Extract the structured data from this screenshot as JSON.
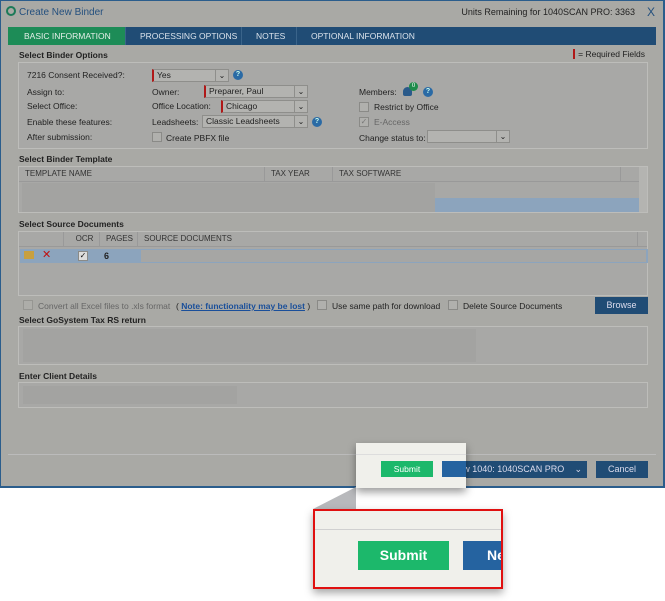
{
  "header": {
    "title": "Create New Binder",
    "units": "Units Remaining for 1040SCAN PRO: 3363",
    "close": "X"
  },
  "tabs": [
    "BASIC INFORMATION",
    "PROCESSING OPTIONS",
    "NOTES",
    "OPTIONAL INFORMATION"
  ],
  "required_legend": "= Required Fields",
  "binder_options": {
    "section": "Select Binder Options",
    "consent_label": "7216 Consent Received?:",
    "consent_value": "Yes",
    "assign_label": "Assign to:",
    "owner_label": "Owner:",
    "owner_value": "Preparer, Paul",
    "members_label": "Members:",
    "members_count": "0",
    "office_label": "Select Office:",
    "location_label": "Office Location:",
    "location_value": "Chicago",
    "restrict_label": "Restrict by Office",
    "features_label": "Enable these features:",
    "leadsheets_label": "Leadsheets:",
    "leadsheets_value": "Classic Leadsheets",
    "eaccess_label": "E-Access",
    "after_label": "After submission:",
    "pbfx_label": "Create PBFX file",
    "status_label": "Change status to:",
    "status_value": ""
  },
  "template": {
    "section": "Select Binder Template",
    "columns": [
      "TEMPLATE NAME",
      "TAX YEAR",
      "TAX SOFTWARE"
    ]
  },
  "source": {
    "section": "Select Source Documents",
    "columns": [
      "OCR",
      "PAGES",
      "SOURCE DOCUMENTS"
    ],
    "row": {
      "pages": "6"
    },
    "convert_label": "Convert all Excel files to .xls format",
    "note_open": "(",
    "note_link": "Note: functionality may be lost",
    "note_close": ")",
    "same_path_label": "Use same path for download",
    "delete_label": "Delete Source Documents",
    "browse": "Browse"
  },
  "gosystem": {
    "section": "Select GoSystem Tax RS return"
  },
  "client": {
    "section": "Enter Client Details"
  },
  "footer": {
    "submit": "Submit",
    "new_return": "New 1040: 1040SCAN PRO",
    "cancel": "Cancel"
  },
  "callout": {
    "submit": "Submit",
    "new_partial": "Ne"
  }
}
